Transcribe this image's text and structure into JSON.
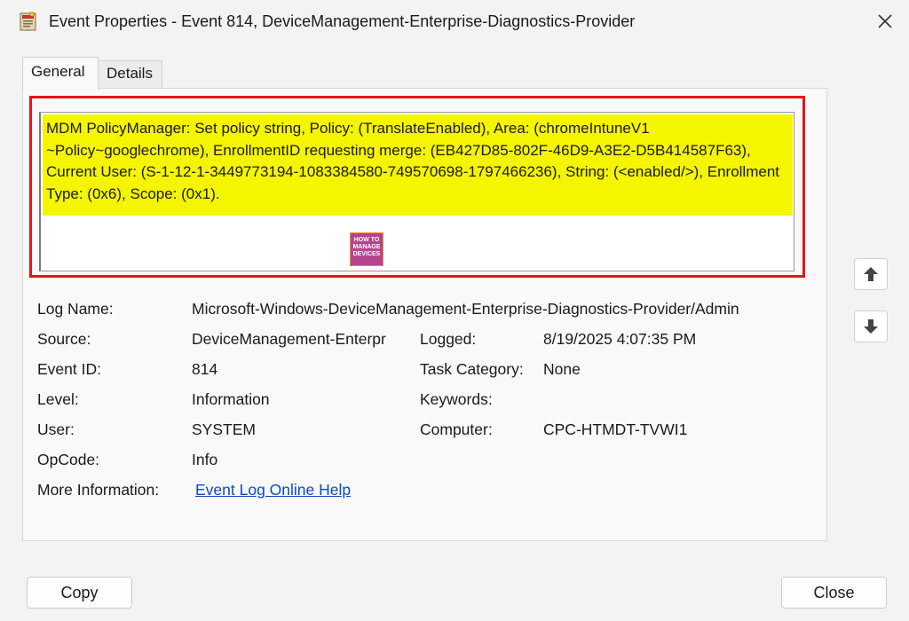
{
  "window": {
    "title": "Event Properties - Event 814, DeviceManagement-Enterprise-Diagnostics-Provider"
  },
  "tabs": [
    {
      "label": "General",
      "selected": true
    },
    {
      "label": "Details",
      "selected": false
    }
  ],
  "message": "MDM PolicyManager: Set policy string, Policy: (TranslateEnabled), Area: (chromeIntuneV1 ~Policy~googlechrome), EnrollmentID requesting merge: (EB427D85-802F-46D9-A3E2-D5B414587F63), Current User: (S-1-12-1-3449773194-1083384580-749570698-1797466236), String: (<enabled/>), Enrollment Type: (0x6), Scope: (0x1).",
  "watermark": {
    "line1": "HOW TO",
    "line2": "MANAGE",
    "line3": "DEVICES"
  },
  "fields": {
    "log_name": {
      "label": "Log Name:",
      "value": "Microsoft-Windows-DeviceManagement-Enterprise-Diagnostics-Provider/Admin"
    },
    "source": {
      "label": "Source:",
      "value": "DeviceManagement-Enterpr"
    },
    "logged": {
      "label": "Logged:",
      "value": "8/19/2025 4:07:35 PM"
    },
    "event_id": {
      "label": "Event ID:",
      "value": "814"
    },
    "task_category": {
      "label": "Task Category:",
      "value": "None"
    },
    "level": {
      "label": "Level:",
      "value": "Information"
    },
    "keywords": {
      "label": "Keywords:",
      "value": ""
    },
    "user": {
      "label": "User:",
      "value": "SYSTEM"
    },
    "computer": {
      "label": "Computer:",
      "value": "CPC-HTMDT-TVWI1"
    },
    "opcode": {
      "label": "OpCode:",
      "value": "Info"
    },
    "more_info": {
      "label": "More Information:",
      "link": "Event Log Online Help"
    }
  },
  "buttons": {
    "copy": "Copy",
    "close": "Close"
  },
  "icons": {
    "app": "event-viewer-icon",
    "close": "close-icon",
    "up": "arrow-up-icon",
    "down": "arrow-down-icon"
  },
  "colors": {
    "highlight": "#f5f500",
    "frame": "#e0161e",
    "link": "#0a49c5"
  }
}
